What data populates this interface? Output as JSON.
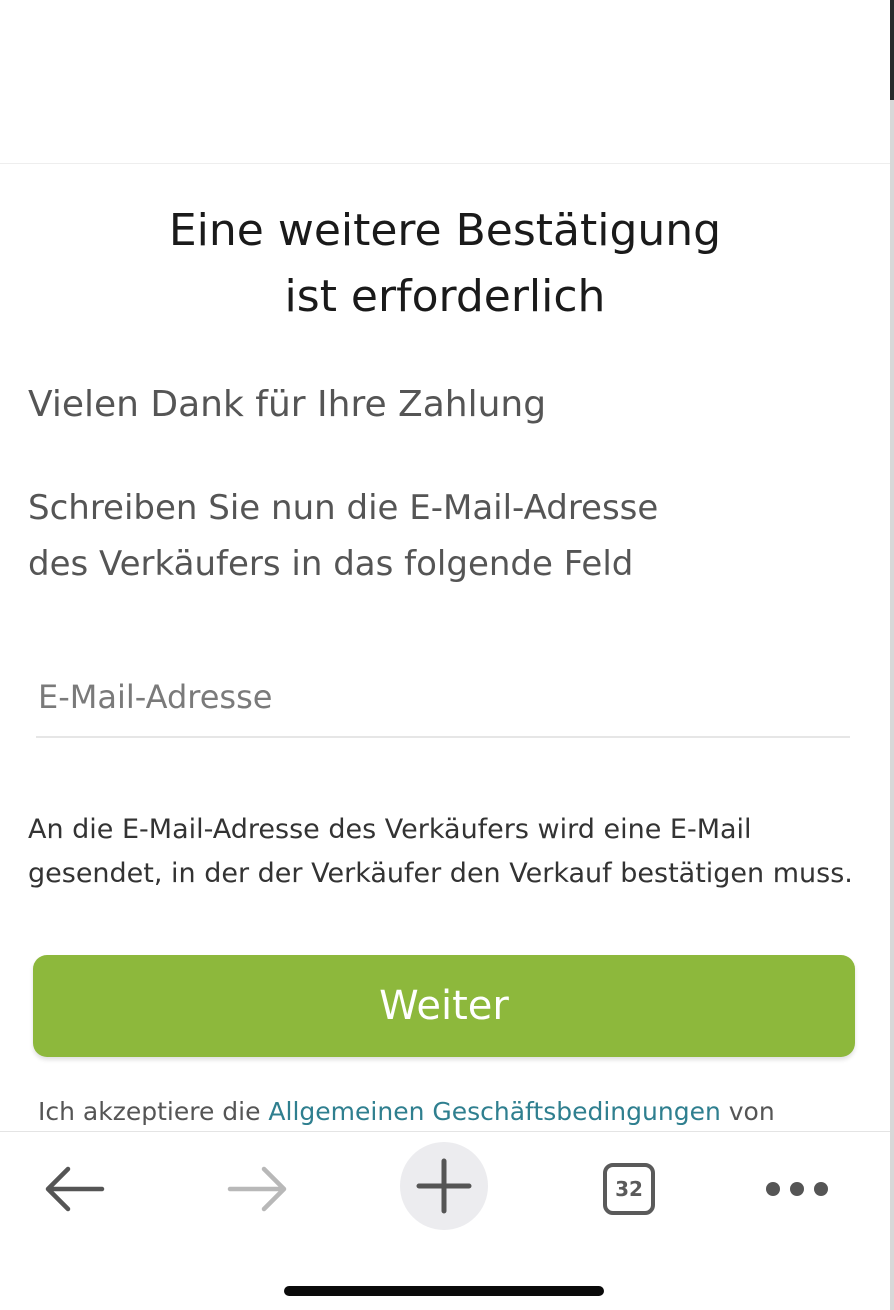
{
  "dialog": {
    "title_line1": "Eine weitere Bestätigung",
    "title_line2": "ist erforderlich",
    "thanks": "Vielen Dank für Ihre Zahlung",
    "instruction_line1": "Schreiben Sie nun die E-Mail-Adresse",
    "instruction_line2": "des Verkäufers in das folgende Feld",
    "email_placeholder": "E-Mail-Adresse",
    "email_value": "",
    "notice_line1": "An die E-Mail-Adresse des Verkäufers wird eine E-Mail",
    "notice_line2": "gesendet, in der der Verkäufer den Verkauf bestätigen muss.",
    "continue_label": "Weiter",
    "terms_prefix": "Ich akzeptiere die ",
    "terms_link": "Allgemeinen Geschäftsbedingungen",
    "terms_suffix": " von"
  },
  "toolbar": {
    "tab_count": "32",
    "icons": {
      "back": "arrow-left-icon",
      "forward": "arrow-right-icon",
      "new_tab": "plus-icon",
      "tabs": "tabs-icon",
      "more": "more-dots-icon"
    }
  },
  "colors": {
    "button": "#8db83c",
    "link": "#2f7f8f",
    "text": "#555555",
    "title": "#1a1a1a"
  }
}
